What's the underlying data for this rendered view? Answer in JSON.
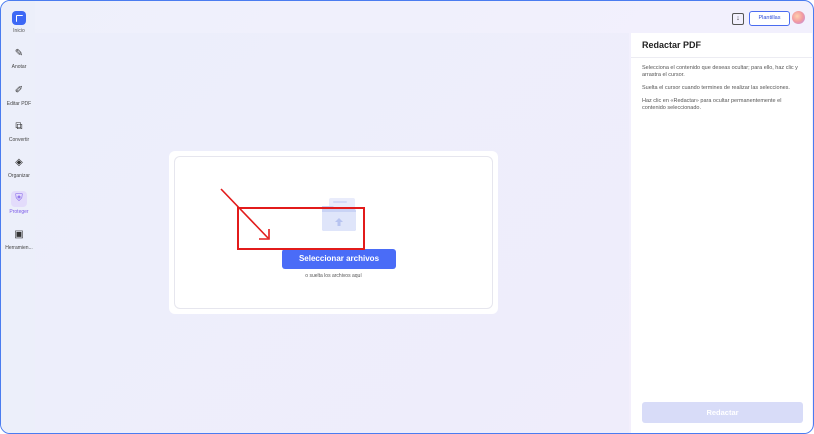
{
  "sidebar": {
    "logo_label": "Inicio",
    "items": [
      {
        "label": "Anotar",
        "icon": "annotate-icon"
      },
      {
        "label": "Editar PDF",
        "icon": "edit-pen-icon"
      },
      {
        "label": "Convertir",
        "icon": "convert-icon"
      },
      {
        "label": "Organizar",
        "icon": "layers-icon"
      },
      {
        "label": "Proteger",
        "icon": "shield-icon"
      },
      {
        "label": "Herramien...",
        "icon": "toolbox-icon"
      }
    ],
    "active_label": "Proteger"
  },
  "topbar": {
    "templates_label": "Plantillas"
  },
  "upload": {
    "button_label": "Seleccionar archivos",
    "drop_hint": "o suelta los archivos aquí"
  },
  "panel": {
    "title": "Redactar PDF",
    "instructions": [
      "Selecciona el contenido que deseas ocultar; para ello, haz clic y arrastra el cursor.",
      "Suelta el cursor cuando termines de realizar las selecciones.",
      "Haz clic en «Redactar» para ocultar permanentemente el contenido seleccionado."
    ],
    "action_label": "Redactar"
  },
  "colors": {
    "accent": "#4a6cf7",
    "annotation_red": "#e21b1b",
    "active_nav": "#7b5ae8",
    "disabled_button": "#d8dcf8"
  }
}
